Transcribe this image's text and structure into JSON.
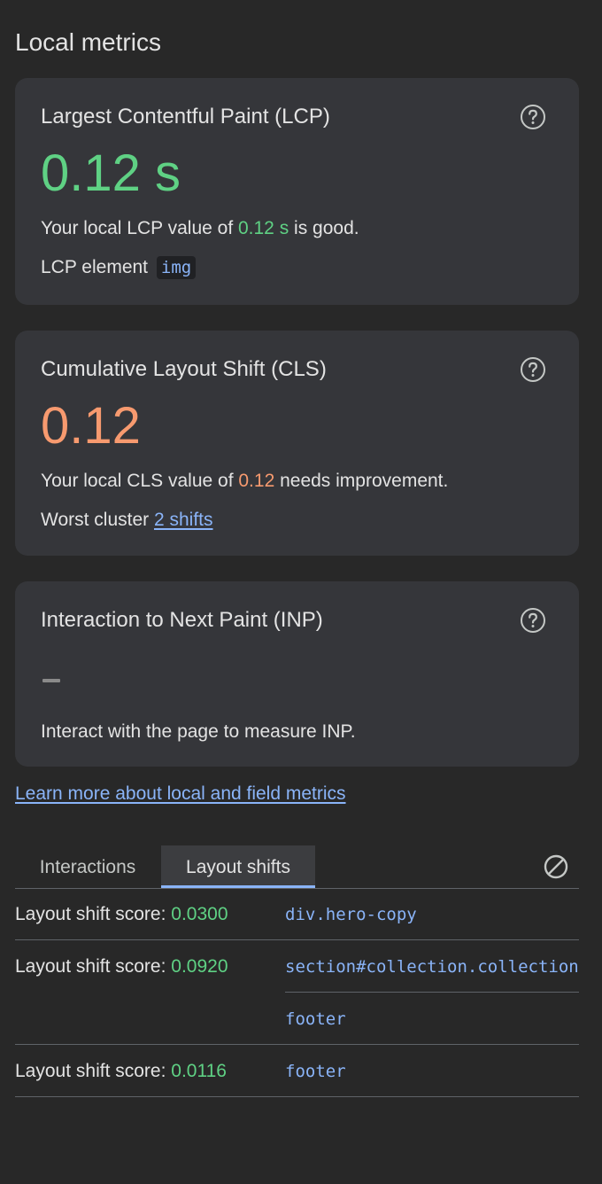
{
  "section_title": "Local metrics",
  "lcp": {
    "title": "Largest Contentful Paint (LCP)",
    "value": "0.12 s",
    "desc_prefix": "Your local LCP value of ",
    "desc_value": "0.12 s",
    "desc_suffix": " is good.",
    "element_label": "LCP element",
    "element_value": "img"
  },
  "cls": {
    "title": "Cumulative Layout Shift (CLS)",
    "value": "0.12",
    "desc_prefix": "Your local CLS value of ",
    "desc_value": "0.12",
    "desc_suffix": " needs improvement.",
    "cluster_label": "Worst cluster",
    "cluster_link": "2 shifts"
  },
  "inp": {
    "title": "Interaction to Next Paint (INP)",
    "value_placeholder": "–",
    "desc": "Interact with the page to measure INP."
  },
  "learn_more": "Learn more about local and field metrics",
  "tabs": [
    {
      "label": "Interactions",
      "active": false
    },
    {
      "label": "Layout shifts",
      "active": true
    }
  ],
  "shift_label": "Layout shift score: ",
  "shifts": [
    {
      "score": "0.0300",
      "nodes": [
        "div.hero-copy"
      ]
    },
    {
      "score": "0.0920",
      "nodes": [
        "section#collection.collection",
        "footer"
      ]
    },
    {
      "score": "0.0116",
      "nodes": [
        "footer"
      ]
    }
  ],
  "colors": {
    "good": "#5fd184",
    "needs_improvement": "#f79a6f",
    "link": "#8ab4f8",
    "card_bg": "#35363a",
    "page_bg": "#282828"
  },
  "icons": [
    "help-circle-icon",
    "clear-circle-slash-icon"
  ]
}
